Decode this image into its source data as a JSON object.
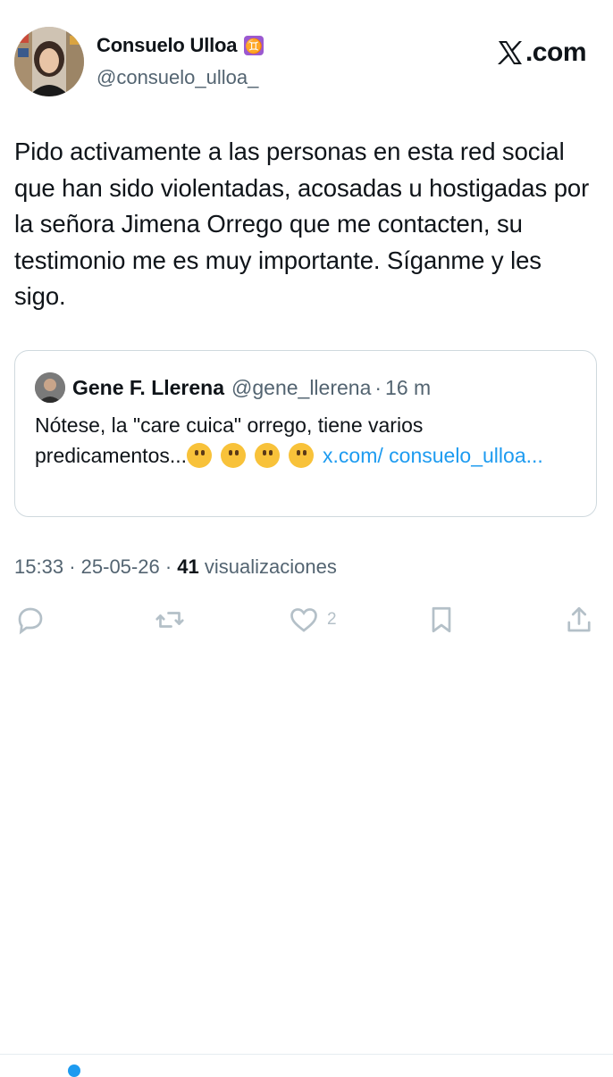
{
  "author": {
    "display_name": "Consuelo Ulloa",
    "badge_icon": "gemini-zodiac-icon",
    "badge_glyph": "♊",
    "handle": "@consuelo_ulloa_"
  },
  "brand": {
    "logo_icon": "x-logo-icon",
    "text": ".com"
  },
  "tweet": {
    "text": "Pido activamente a las personas en esta red social que han sido violentadas, acosadas u hostigadas por la señora Jimena Orrego que me contacten, su testimonio me es muy importante. Síganme y les sigo."
  },
  "quoted": {
    "name": "Gene F. Llerena",
    "handle": "@gene_llerena",
    "separator": "·",
    "time": "16 m",
    "text": "Nótese, la \"care cuica\" orrego, tiene varios predicamentos...",
    "emoji": [
      "thinking-face-icon",
      "thinking-face-icon",
      "thinking-face-icon",
      "thinking-face-icon"
    ],
    "link_text": "x.com/ consuelo_ulloa..."
  },
  "meta": {
    "time": "15:33",
    "date": "25-05-26",
    "sep": "·",
    "views_count": "41",
    "views_label": "visualizaciones"
  },
  "actions": {
    "reply_icon": "reply-icon",
    "repost_icon": "repost-icon",
    "like_icon": "heart-icon",
    "like_count": "2",
    "bookmark_icon": "bookmark-icon",
    "share_icon": "share-icon"
  },
  "colors": {
    "accent": "#1d9bf0",
    "text": "#0f1419",
    "secondary": "#536471",
    "icon_muted": "#b4c0c8",
    "border": "#cfd9de",
    "badge": "#9b59d0"
  }
}
